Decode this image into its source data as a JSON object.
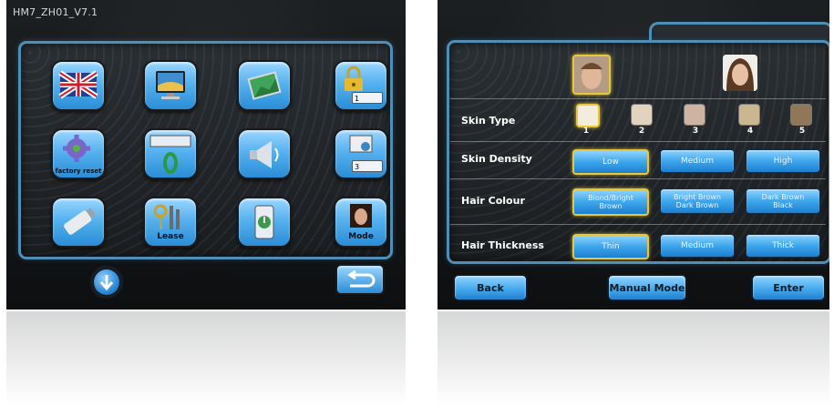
{
  "left_screen": {
    "version": "HM7_ZH01_V7.1",
    "tiles": [
      {
        "icon": "uk-flag-icon"
      },
      {
        "icon": "monitor-icon"
      },
      {
        "icon": "picture-icon"
      },
      {
        "icon": "lock-icon",
        "field_value": "1"
      },
      {
        "icon": "gear-icon",
        "label": "factory reset"
      },
      {
        "icon": "counter-reset-icon"
      },
      {
        "icon": "speaker-icon"
      },
      {
        "icon": "settings-window-icon",
        "field_value": "3"
      },
      {
        "icon": "usb-drive-icon"
      },
      {
        "icon": "keys-icon",
        "label": "Lease"
      },
      {
        "icon": "timer-icon"
      },
      {
        "icon": "portrait-icon",
        "label": "Mode"
      }
    ],
    "down_icon": "arrow-down-icon",
    "return_icon": "return-arrow-icon"
  },
  "right_screen": {
    "genders": [
      "male-face",
      "female-face"
    ],
    "rows": {
      "skin_type": {
        "label": "Skin Type",
        "options": [
          "1",
          "2",
          "3",
          "4",
          "5"
        ],
        "selected": "1"
      },
      "skin_density": {
        "label": "Skin Density",
        "options": [
          "Low",
          "Medium",
          "High"
        ],
        "selected": "Low"
      },
      "hair_colour": {
        "label": "Hair Colour",
        "options": [
          [
            "Blond/Bright",
            "Brown"
          ],
          [
            "Bright Brown",
            "Dark Brown"
          ],
          [
            "Dark Brown",
            "Black"
          ]
        ],
        "selected": 0
      },
      "hair_thickness": {
        "label": "Hair Thickness",
        "options": [
          "Thin",
          "Medium",
          "Thick"
        ],
        "selected": "Thin"
      }
    },
    "buttons": {
      "back": "Back",
      "manual": "Manual Mode",
      "enter": "Enter"
    },
    "colors": {
      "accent": "#4d8fb6",
      "selected_border": "#e6c838",
      "button": "#3da6ec"
    }
  }
}
